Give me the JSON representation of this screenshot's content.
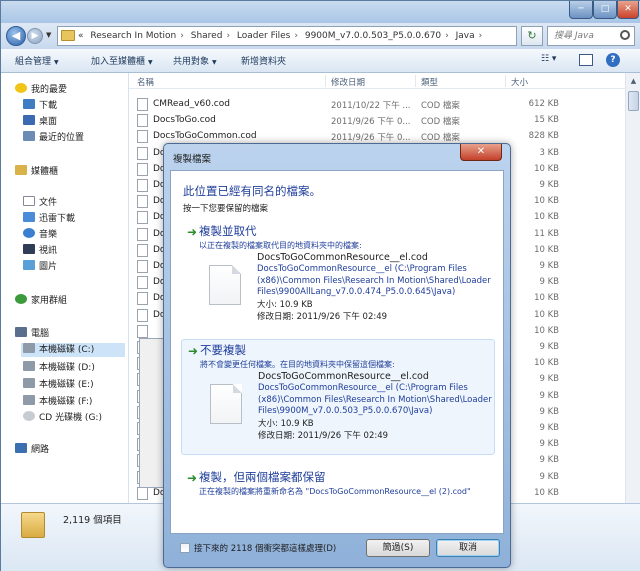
{
  "explorer": {
    "address_path": [
      "«",
      "Research In Motion",
      "Shared",
      "Loader Files",
      "9900M_v7.0.0.503_P5.0.0.670",
      "Java"
    ],
    "search_placeholder": "搜尋 Java",
    "toolbar": {
      "organize": "組合管理",
      "add_to_library": "加入至媒體櫃",
      "share_with": "共用對象",
      "new_folder": "新增資料夾"
    },
    "columns": {
      "name": "名稱",
      "date": "修改日期",
      "type": "類型",
      "size": "大小"
    },
    "nav": {
      "favorites": "我的最愛",
      "downloads": "下載",
      "desktop": "桌面",
      "recent": "最近的位置",
      "libraries": "媒體櫃",
      "documents": "文件",
      "thunder": "迅雷下載",
      "music": "音樂",
      "videos": "視訊",
      "pictures": "圖片",
      "homegroup": "家用群組",
      "computer": "電腦",
      "drive_c": "本機磁碟 (C:)",
      "drive_d": "本機磁碟 (D:)",
      "drive_e": "本機磁碟 (E:)",
      "drive_f": "本機磁碟 (F:)",
      "drive_g": "CD 光碟機 (G:)",
      "network": "網路"
    },
    "files": [
      {
        "name": "CMRead_v60.cod",
        "date": "2011/10/22 下午 ...",
        "type": "COD 檔案",
        "size": "612 KB"
      },
      {
        "name": "DocsToGo.cod",
        "date": "2011/9/26 下午 0...",
        "type": "COD 檔案",
        "size": "15 KB"
      },
      {
        "name": "DocsToGoCommon.cod",
        "date": "2011/9/26 下午 0...",
        "type": "COD 檔案",
        "size": "828 KB"
      },
      {
        "name": "Do",
        "date": "",
        "type": "",
        "size": "3 KB"
      },
      {
        "name": "Do",
        "date": "",
        "type": "",
        "size": "10 KB"
      },
      {
        "name": "Do",
        "date": "",
        "type": "",
        "size": "9 KB"
      },
      {
        "name": "Do",
        "date": "",
        "type": "",
        "size": "10 KB"
      },
      {
        "name": "Do",
        "date": "",
        "type": "",
        "size": "10 KB"
      },
      {
        "name": "Do",
        "date": "",
        "type": "",
        "size": "11 KB"
      },
      {
        "name": "Do",
        "date": "",
        "type": "",
        "size": "10 KB"
      },
      {
        "name": "Do",
        "date": "",
        "type": "",
        "size": "9 KB"
      },
      {
        "name": "Do",
        "date": "",
        "type": "",
        "size": "9 KB"
      },
      {
        "name": "Do",
        "date": "",
        "type": "",
        "size": "10 KB"
      },
      {
        "name": "Do",
        "date": "",
        "type": "",
        "size": "10 KB"
      },
      {
        "name": "",
        "date": "",
        "type": "",
        "size": "10 KB"
      },
      {
        "name": "",
        "date": "",
        "type": "",
        "size": "9 KB"
      },
      {
        "name": "",
        "date": "",
        "type": "",
        "size": "10 KB"
      },
      {
        "name": "",
        "date": "",
        "type": "",
        "size": "9 KB"
      },
      {
        "name": "",
        "date": "",
        "type": "",
        "size": "9 KB"
      },
      {
        "name": "",
        "date": "",
        "type": "",
        "size": "9 KB"
      },
      {
        "name": "",
        "date": "",
        "type": "",
        "size": "9 KB"
      },
      {
        "name": "",
        "date": "",
        "type": "",
        "size": "9 KB"
      },
      {
        "name": "",
        "date": "",
        "type": "",
        "size": "9 KB"
      },
      {
        "name": "",
        "date": "",
        "type": "",
        "size": "9 KB"
      },
      {
        "name": "Do",
        "date": "",
        "type": "",
        "size": "10 KB"
      }
    ],
    "item_count": "2,119 個項目"
  },
  "dialog": {
    "title": "複製檔案",
    "heading": "此位置已經有同名的檔案。",
    "subheading": "按一下您要保留的檔案",
    "option1": {
      "title": "複製並取代",
      "desc": "以正在複製的檔案取代目的地資料夾中的檔案:",
      "filename": "DocsToGoCommonResource__el.cod",
      "path": "DocsToGoCommonResource__el (C:\\Program Files (x86)\\Common Files\\Research In Motion\\Shared\\Loader Files\\9900AllLang_v7.0.0.474_P5.0.0.645\\Java)",
      "size": "大小: 10.9 KB",
      "modified": "修改日期: 2011/9/26 下午 02:49"
    },
    "option2": {
      "title": "不要複製",
      "desc": "將不會變更任何檔案。在目的地資料夾中保留這個檔案:",
      "filename": "DocsToGoCommonResource__el.cod",
      "path": "DocsToGoCommonResource__el (C:\\Program Files (x86)\\Common Files\\Research In Motion\\Shared\\Loader Files\\9900M_v7.0.0.503_P5.0.0.670\\Java)",
      "size": "大小: 10.9 KB",
      "modified": "修改日期: 2011/9/26 下午 02:49"
    },
    "option3": {
      "title": "複製，但兩個檔案都保留",
      "desc": "正在複製的檔案將重新命名為 \"DocsToGoCommonResource__el (2).cod\""
    },
    "checkbox_label": "接下來的 2118 個衝突都這樣處理(D)",
    "details_button": "簡過(S)",
    "cancel_button": "取消"
  }
}
